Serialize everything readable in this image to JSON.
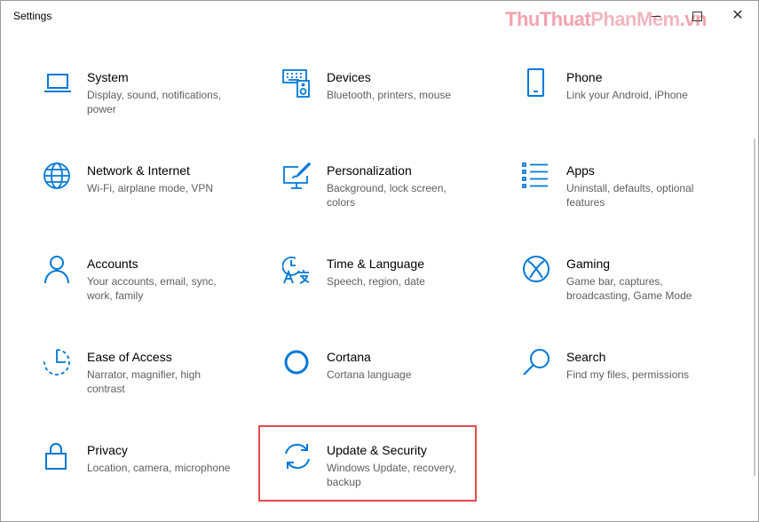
{
  "window": {
    "title": "Settings",
    "watermark_a": "ThuThuat",
    "watermark_b": "PhanMem",
    "watermark_c": ".vn"
  },
  "accent_color": "#0078d7",
  "highlight_color": "#e24b4b",
  "tiles": [
    {
      "name": "System",
      "desc": "Display, sound, notifications, power",
      "icon": "laptop-icon"
    },
    {
      "name": "Devices",
      "desc": "Bluetooth, printers, mouse",
      "icon": "keyboard-speaker-icon"
    },
    {
      "name": "Phone",
      "desc": "Link your Android, iPhone",
      "icon": "phone-icon"
    },
    {
      "name": "Network & Internet",
      "desc": "Wi-Fi, airplane mode, VPN",
      "icon": "globe-icon"
    },
    {
      "name": "Personalization",
      "desc": "Background, lock screen, colors",
      "icon": "paint-screen-icon"
    },
    {
      "name": "Apps",
      "desc": "Uninstall, defaults, optional features",
      "icon": "apps-list-icon"
    },
    {
      "name": "Accounts",
      "desc": "Your accounts, email, sync, work, family",
      "icon": "person-icon"
    },
    {
      "name": "Time & Language",
      "desc": "Speech, region, date",
      "icon": "language-icon"
    },
    {
      "name": "Gaming",
      "desc": "Game bar, captures, broadcasting, Game Mode",
      "icon": "xbox-icon"
    },
    {
      "name": "Ease of Access",
      "desc": "Narrator, magnifier, high contrast",
      "icon": "ease-of-access-icon"
    },
    {
      "name": "Cortana",
      "desc": "Cortana language",
      "icon": "cortana-icon"
    },
    {
      "name": "Search",
      "desc": "Find my files, permissions",
      "icon": "search-icon"
    },
    {
      "name": "Privacy",
      "desc": "Location, camera, microphone",
      "icon": "lock-icon"
    },
    {
      "name": "Update & Security",
      "desc": "Windows Update, recovery, backup",
      "icon": "sync-icon"
    }
  ]
}
